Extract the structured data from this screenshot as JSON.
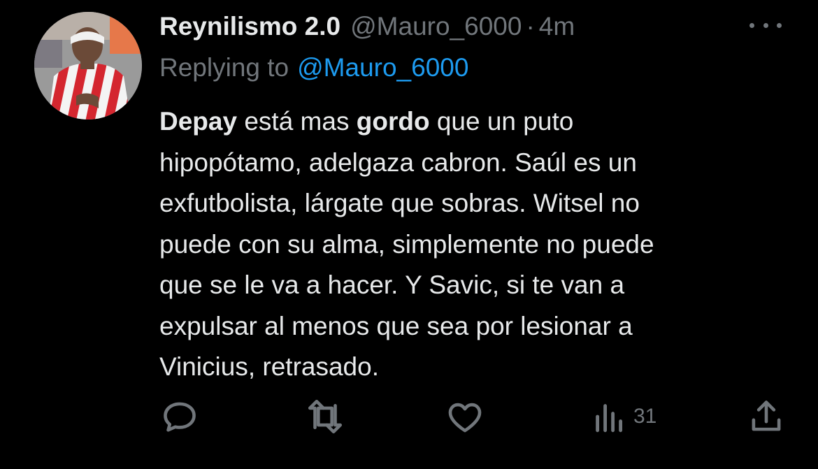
{
  "tweet": {
    "author": {
      "display_name": "Reynilismo 2.0",
      "handle": "@Mauro_6000",
      "separator": "·",
      "time": "4m"
    },
    "reply": {
      "prefix": "Replying to",
      "mention": "@Mauro_6000"
    },
    "text_segments": {
      "l1_b1": "Depay",
      "l1_t1": " está mas ",
      "l1_b2": "gordo",
      "l1_t2": " que un puto",
      "l2": "hipopótamo, adelgaza cabron. Saúl es un",
      "l3": "exfutbolista, lárgate que sobras. Witsel no",
      "l4": "puede con su alma, simplemente no puede",
      "l5": "que se le va a hacer. Y Savic, si te van a",
      "l6": "expulsar al menos que sea por lesionar a",
      "l7": "Vinicius, retrasado."
    },
    "actions": {
      "views_count": "31",
      "icons": [
        "comment-icon",
        "retweet-icon",
        "like-icon",
        "views-icon",
        "share-icon"
      ]
    },
    "colors": {
      "background": "#000000",
      "primary_text": "#e7e9ea",
      "secondary_text": "#71767b",
      "link": "#1d9bf0"
    }
  }
}
